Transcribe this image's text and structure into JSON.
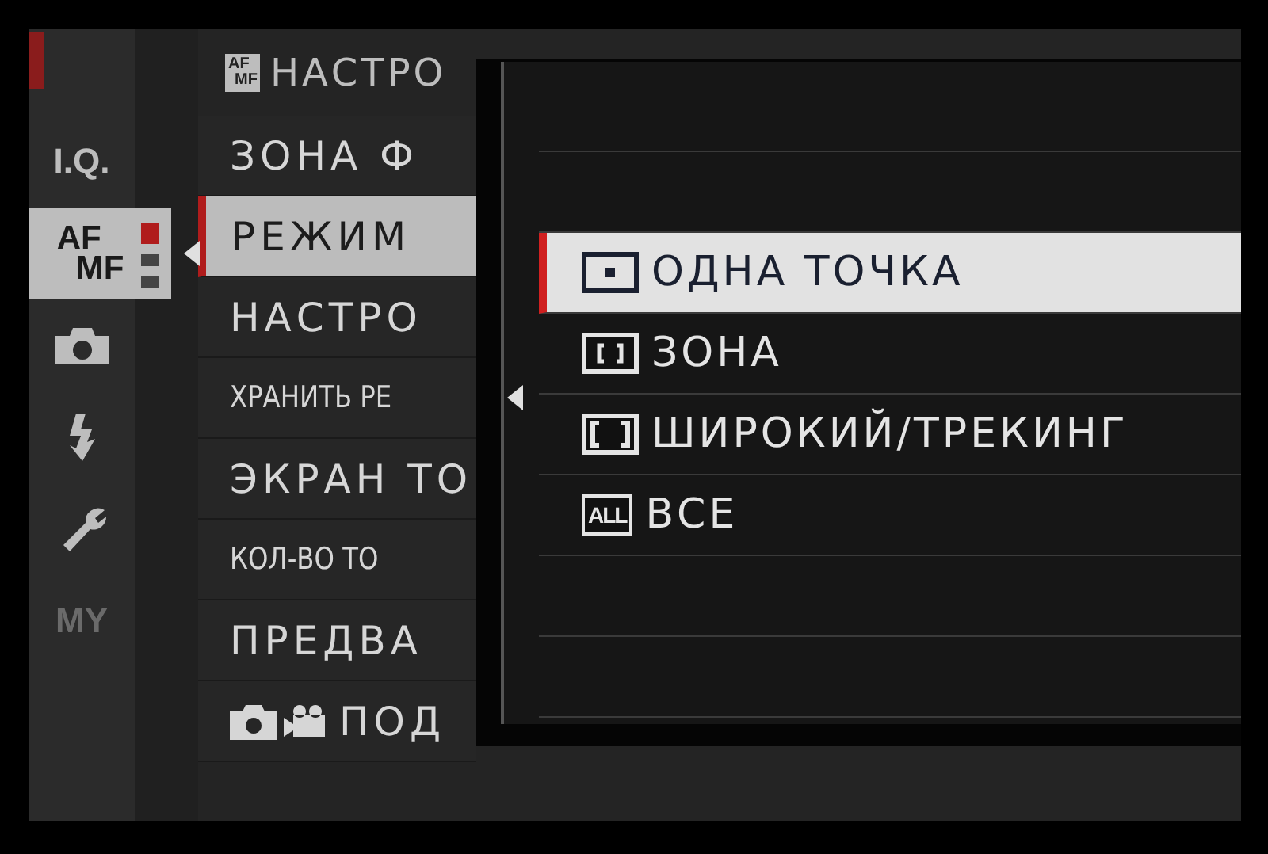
{
  "header": {
    "icon_text": [
      "AF",
      "MF"
    ],
    "title": "НАСТРО"
  },
  "sidebar": {
    "items": [
      {
        "kind": "iq",
        "label": "I.Q.",
        "selected": false
      },
      {
        "kind": "afmf",
        "label": [
          "AF",
          "MF"
        ],
        "selected": true
      },
      {
        "kind": "camera",
        "selected": false
      },
      {
        "kind": "flash",
        "selected": false
      },
      {
        "kind": "wrench",
        "selected": false
      },
      {
        "kind": "my",
        "label": "MY",
        "selected": false
      }
    ],
    "pages": [
      {
        "selected": true
      },
      {
        "selected": false
      },
      {
        "selected": false
      }
    ]
  },
  "menu": {
    "items": [
      {
        "kind": "text",
        "label": "ЗОНА Ф",
        "selected": false
      },
      {
        "kind": "text",
        "label": "РЕЖИМ",
        "selected": true
      },
      {
        "kind": "text",
        "label": "НАСТРО",
        "selected": false
      },
      {
        "kind": "small",
        "label": "ХРАНИТЬ РЕ",
        "selected": false
      },
      {
        "kind": "text",
        "label": "ЭКРАН ТО",
        "selected": false
      },
      {
        "kind": "small",
        "label": "КОЛ-ВО ТО",
        "selected": false
      },
      {
        "kind": "text",
        "label": "ПРЕДВА",
        "selected": false
      },
      {
        "kind": "photo_video",
        "label": "ПОД",
        "selected": false
      }
    ]
  },
  "popup": {
    "options": [
      {
        "kind": "single",
        "label": "ОДНА ТОЧКА",
        "selected": true
      },
      {
        "kind": "zone",
        "label": "ЗОНА",
        "selected": false
      },
      {
        "kind": "wide",
        "label": "ШИРОКИЙ/ТРЕКИНГ",
        "selected": false
      },
      {
        "kind": "all",
        "icon_text": "ALL",
        "label": "ВСЕ",
        "selected": false
      }
    ]
  }
}
